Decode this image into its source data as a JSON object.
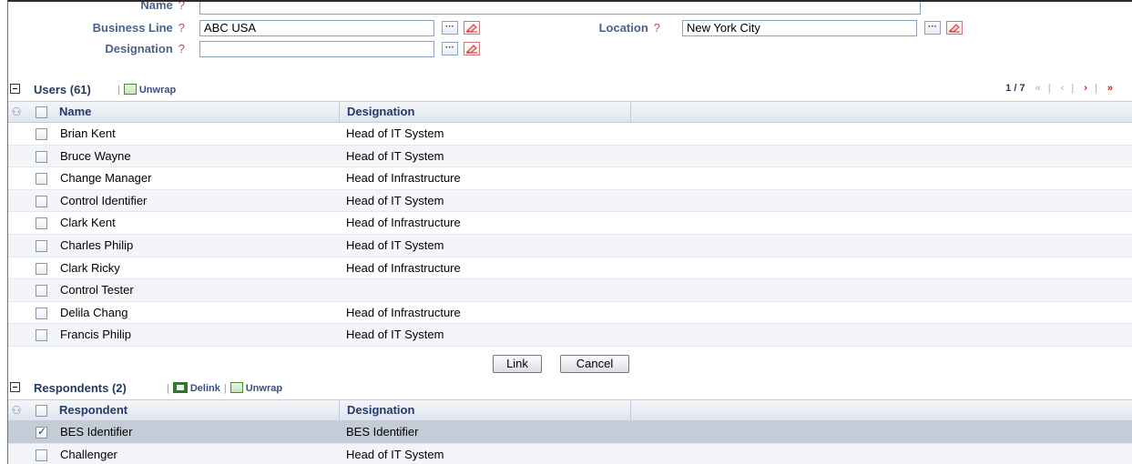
{
  "form": {
    "name_label": "Name",
    "business_line_label": "Business Line",
    "business_line_value": "ABC USA",
    "location_label": "Location",
    "location_value": "New York City",
    "designation_label": "Designation",
    "designation_value": "",
    "help_mark": "?",
    "picker_glyph": "···"
  },
  "users": {
    "title": "Users (61)",
    "unwrap_label": "Unwrap",
    "pager": {
      "text": "1 / 7",
      "first": "«",
      "prev": "‹",
      "next": "›",
      "last": "»"
    },
    "col_name": "Name",
    "col_designation": "Designation",
    "rows": [
      {
        "name": "Brian Kent",
        "designation": "Head of IT System"
      },
      {
        "name": "Bruce Wayne",
        "designation": "Head of IT System"
      },
      {
        "name": "Change Manager",
        "designation": "Head of Infrastructure"
      },
      {
        "name": "Control Identifier",
        "designation": "Head of IT System"
      },
      {
        "name": "Clark Kent",
        "designation": "Head of Infrastructure"
      },
      {
        "name": "Charles Philip",
        "designation": "Head of IT System"
      },
      {
        "name": "Clark Ricky",
        "designation": "Head of Infrastructure"
      },
      {
        "name": "Control Tester",
        "designation": ""
      },
      {
        "name": "Delila Chang",
        "designation": "Head of Infrastructure"
      },
      {
        "name": "Francis Philip",
        "designation": "Head of IT System"
      }
    ]
  },
  "actions": {
    "link_label": "Link",
    "cancel_label": "Cancel"
  },
  "respondents": {
    "title": "Respondents (2)",
    "delink_label": "Delink",
    "unwrap_label": "Unwrap",
    "col_respondent": "Respondent",
    "col_designation": "Designation",
    "rows": [
      {
        "name": "BES Identifier",
        "designation": "BES Identifier",
        "checked": true
      },
      {
        "name": "Challenger",
        "designation": "Head of IT System",
        "checked": false
      }
    ]
  },
  "colors": {
    "label_blue": "#4a628a",
    "header_blue": "#233a63",
    "selected_row": "#c3ccd7",
    "pager_active": "#dd1111"
  },
  "icons": [
    "collapse-icon",
    "unwrap-icon",
    "delink-icon",
    "hierarchy-icon",
    "ellipsis-icon",
    "clear-eraser-icon",
    "help-icon"
  ]
}
